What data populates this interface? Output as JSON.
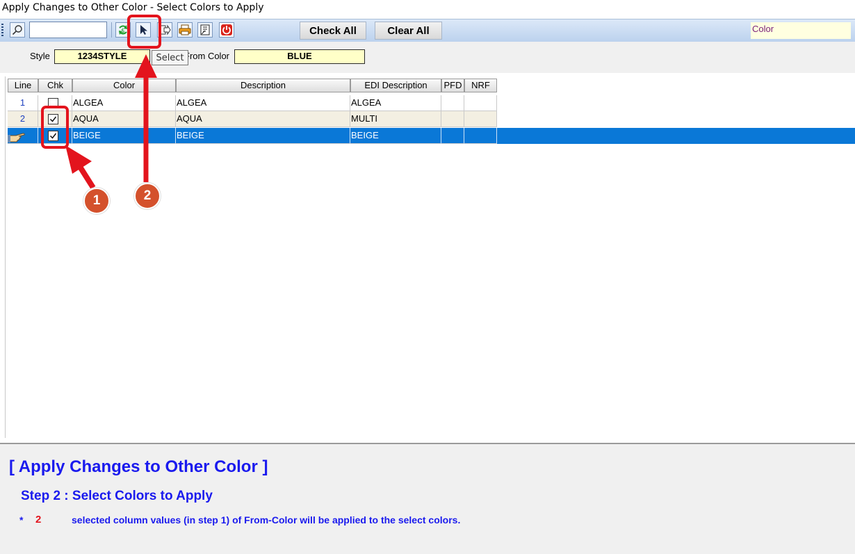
{
  "window": {
    "title": "Apply Changes to Other Color - Select Colors to Apply"
  },
  "toolbar": {
    "search_value": "",
    "check_all_label": "Check All",
    "clear_all_label": "Clear All",
    "color_field_value": "Color",
    "icons": [
      "search-icon",
      "refresh-icon",
      "select-arrow-icon",
      "export-icon",
      "print-icon",
      "report-icon",
      "exit-icon"
    ],
    "tooltip": "Select"
  },
  "header": {
    "style_label": "Style",
    "style_value": "1234STYLE",
    "from_color_label": "From Color",
    "from_color_value": "BLUE"
  },
  "grid": {
    "columns": [
      "Line",
      "Chk",
      "Color",
      "Description",
      "EDI Description",
      "PFD",
      "NRF"
    ],
    "rows": [
      {
        "line": "1",
        "checked": false,
        "color": "ALGEA",
        "description": "ALGEA",
        "edi_description": "ALGEA",
        "pfd": "",
        "nrf": ""
      },
      {
        "line": "2",
        "checked": true,
        "color": "AQUA",
        "description": "AQUA",
        "edi_description": "MULTI",
        "pfd": "",
        "nrf": ""
      },
      {
        "line": "",
        "checked": true,
        "color": "BEIGE",
        "description": "BEIGE",
        "edi_description": "BEIGE",
        "pfd": "",
        "nrf": "",
        "selected": true,
        "row_icon": "pointing-hand-icon"
      }
    ]
  },
  "footer": {
    "title": "[ Apply Changes to Other Color ]",
    "step": "Step 2 :  Select Colors to Apply",
    "note_bullet": "*",
    "note_number": "2",
    "note_text": "selected column values (in step 1) of From-Color will be applied to the select colors."
  },
  "annotations": [
    {
      "number": "1",
      "target": "row checkboxes"
    },
    {
      "number": "2",
      "target": "select button"
    }
  ],
  "colors": {
    "accent_blue": "#1a1aee",
    "selection": "#0a78d7",
    "annotation_red": "#e3141d",
    "badge": "#d4512c"
  }
}
